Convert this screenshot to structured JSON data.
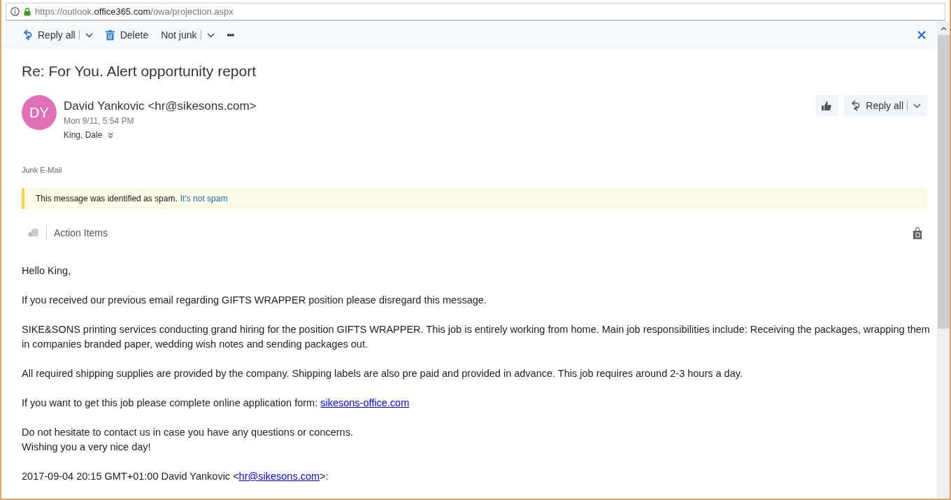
{
  "address_bar": {
    "url_prefix": "https://outlook.",
    "url_domain": "office365.com",
    "url_path": "/owa/projection.aspx"
  },
  "toolbar": {
    "buttons": [
      {
        "kind": "reply",
        "label": "Reply all",
        "dropdown": true
      },
      {
        "kind": "delete",
        "label": "Delete",
        "dropdown": false
      },
      {
        "kind": "plain",
        "label": "Not junk",
        "dropdown": true
      },
      {
        "kind": "more",
        "label": "•••",
        "dropdown": false
      }
    ]
  },
  "subject": "Re: For You. Alert opportunity report",
  "message": {
    "avatar_initials": "DY",
    "sender": "David Yankovic <hr@sikesons.com>",
    "date": "Mon 9/11, 5:54 PM",
    "recipient": "King, Dale",
    "reply_button": "Reply all"
  },
  "folder_label": "Junk E-Mail",
  "spam_notice": {
    "text": "This message was identified as spam.",
    "link": "It's not spam"
  },
  "action_items": {
    "label": "Action Items"
  },
  "body": [
    {
      "lines": [
        [
          {
            "kind": "text",
            "text": "Hello King,"
          }
        ]
      ]
    },
    {
      "lines": [
        [
          {
            "kind": "text",
            "text": "If you received our previous email regarding GIFTS WRAPPER position please disregard this message."
          }
        ]
      ]
    },
    {
      "lines": [
        [
          {
            "kind": "text",
            "text": "SIKE&SONS printing services conducting grand hiring for the position GIFTS WRAPPER. This job is entirely working from home. Main job responsibilities include: Receiving the packages, wrapping them in companies branded paper, wedding wish notes and sending packages out."
          }
        ]
      ]
    },
    {
      "lines": [
        [
          {
            "kind": "text",
            "text": "All required shipping supplies are provided by the company. Shipping labels are also pre paid and provided in advance. This job requires around 2-3 hours a day."
          }
        ]
      ]
    },
    {
      "lines": [
        [
          {
            "kind": "text",
            "text": "If you want to get this job please complete online application form: "
          },
          {
            "kind": "link",
            "text": "sikesons-office.com"
          }
        ]
      ]
    },
    {
      "lines": [
        [
          {
            "kind": "text",
            "text": "Do not hesitate to contact us in case you have any questions or concerns."
          }
        ],
        [
          {
            "kind": "text",
            "text": "Wishing you a very nice day!"
          }
        ]
      ]
    },
    {
      "lines": [
        [
          {
            "kind": "text",
            "text": "2017-09-04 20:15 GMT+01:00 David Yankovic <"
          },
          {
            "kind": "link",
            "text": "hr@sikesons.com"
          },
          {
            "kind": "text",
            "text": ">:"
          }
        ]
      ]
    }
  ]
}
